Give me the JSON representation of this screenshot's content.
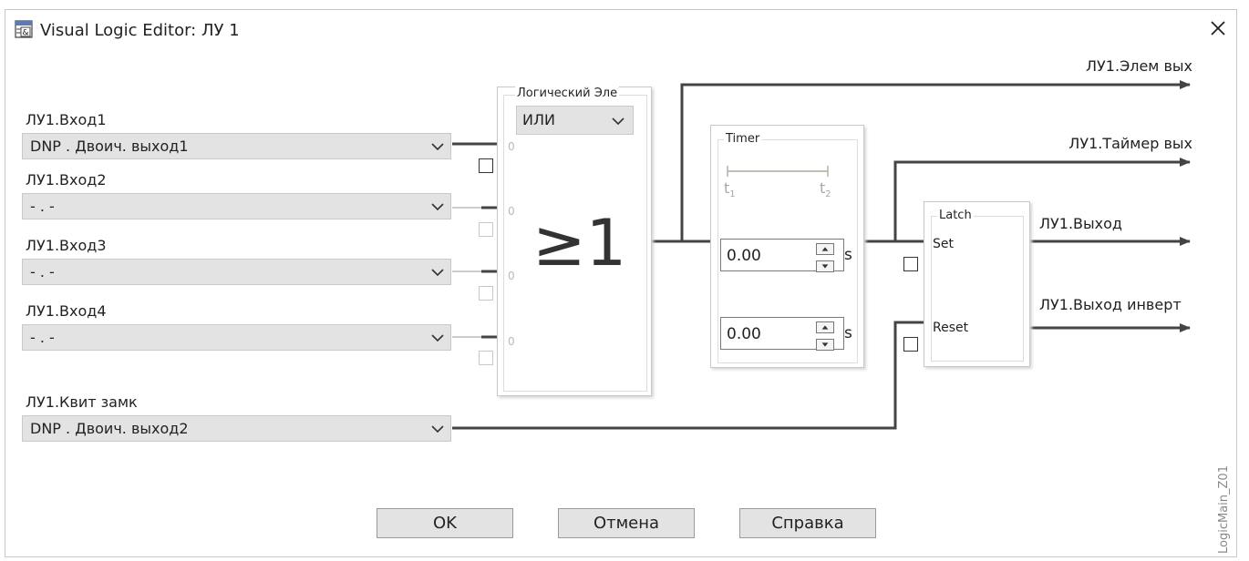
{
  "window": {
    "title": "Visual Logic Editor: ЛУ 1",
    "icon": "logic-editor-icon"
  },
  "inputs": [
    {
      "label": "ЛУ1.Вход1",
      "value": "DNP . Двоич. выход1",
      "pin_value": "0"
    },
    {
      "label": "ЛУ1.Вход2",
      "value": "- . -",
      "pin_value": "0"
    },
    {
      "label": "ЛУ1.Вход3",
      "value": "- . -",
      "pin_value": "0"
    },
    {
      "label": "ЛУ1.Вход4",
      "value": "- . -",
      "pin_value": "0"
    }
  ],
  "reset_input": {
    "label": "ЛУ1.Квит замк",
    "value": "DNP . Двоич. выход2"
  },
  "gate": {
    "title": "Логический Эле",
    "operation": "ИЛИ",
    "symbol": "≥1"
  },
  "timer": {
    "title": "Timer",
    "t1_label": "t",
    "t1_sub": "1",
    "t2_label": "t",
    "t2_sub": "2",
    "delay1": "0.00",
    "delay2": "0.00",
    "unit": "s"
  },
  "latch": {
    "title": "Latch",
    "set_label": "Set",
    "reset_label": "Reset"
  },
  "outputs": {
    "gate_out": "ЛУ1.Элем вых",
    "timer_out": "ЛУ1.Таймер вых",
    "out": "ЛУ1.Выход",
    "out_inverted": "ЛУ1.Выход инверт"
  },
  "buttons": {
    "ok": "OK",
    "cancel": "Отмена",
    "help": "Справка"
  },
  "side_caption": "LogicMain_Z01"
}
